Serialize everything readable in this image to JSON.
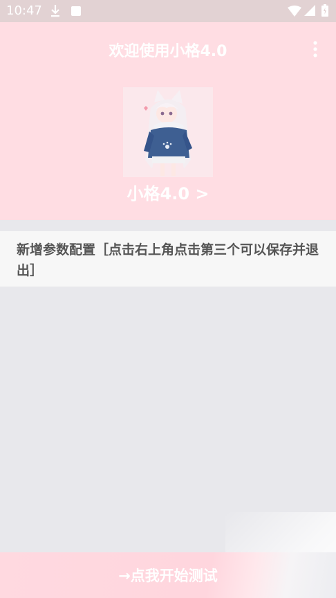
{
  "status_bar": {
    "time": "10:47",
    "icons": [
      "download-icon",
      "a-badge-icon",
      "wifi-icon",
      "signal-icon",
      "battery-icon"
    ],
    "a_badge_letter": "A"
  },
  "header": {
    "title": "欢迎使用小格4.0",
    "menu_icon": "more-vert-icon",
    "profile_name": "小格4.0 >",
    "background": "#ffdde3"
  },
  "notice": {
    "text": "新增参数配置［点击右上角点击第三个可以保存并退出］"
  },
  "footer": {
    "start_label": "→点我开始测试"
  },
  "colors": {
    "status_bar": "#e2d2d3",
    "page_bg": "#e8e8ec",
    "card_bg": "#f7f7f7",
    "accent_text": "#ffffff",
    "notice_text": "#555555"
  }
}
